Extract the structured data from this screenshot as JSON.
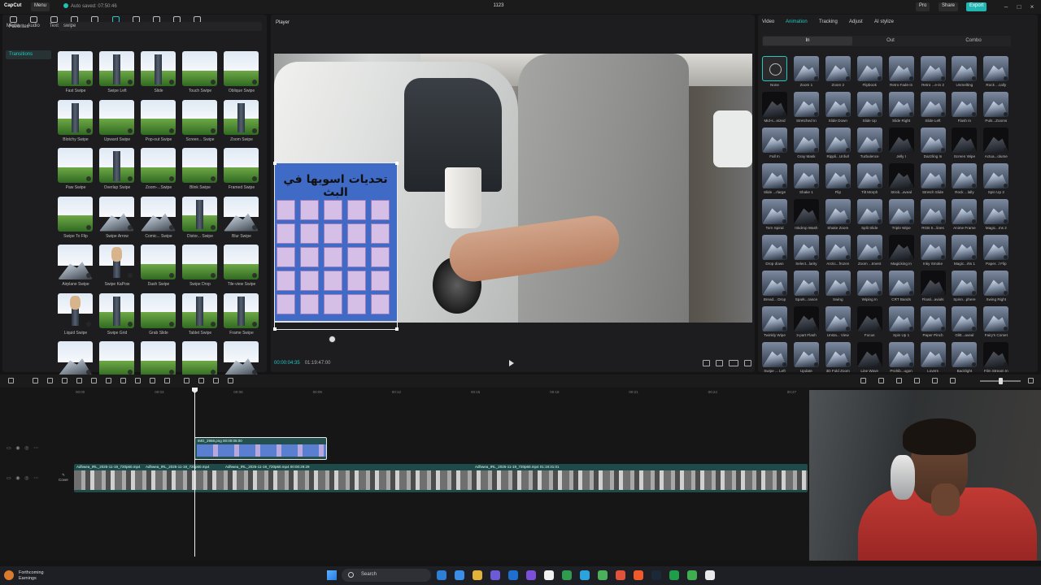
{
  "titlebar": {
    "logo": "CapCut",
    "menu": "Menu",
    "autosave": "Auto saved: 07:50:46",
    "project": "1123",
    "pro": "Pro",
    "share": "Share",
    "export": "Export"
  },
  "left_tools": [
    {
      "label": "Media",
      "icon": "media-icon"
    },
    {
      "label": "Audio",
      "icon": "audio-icon"
    },
    {
      "label": "Text",
      "icon": "text-icon"
    },
    {
      "label": "Stickers",
      "icon": "stickers-icon"
    },
    {
      "label": "Effects",
      "icon": "effects-icon"
    },
    {
      "label": "Transitions",
      "icon": "transitions-icon",
      "active": true
    },
    {
      "label": "Captions",
      "icon": "captions-icon"
    },
    {
      "label": "Filters",
      "icon": "filters-icon"
    },
    {
      "label": "Adjustment",
      "icon": "adjustment-icon"
    },
    {
      "label": "AI avatar",
      "icon": "ai-avatar-icon"
    }
  ],
  "left_nav": {
    "favorites": "Favorites",
    "transitions": "Transitions"
  },
  "search": {
    "value": "swipe"
  },
  "transitions": [
    {
      "label": "Fast Swipe",
      "style": "tower"
    },
    {
      "label": "Swipe Left",
      "style": "tower"
    },
    {
      "label": "Slide",
      "style": "tower"
    },
    {
      "label": "Touch Swipe",
      "style": "grass"
    },
    {
      "label": "Oblique Swipe",
      "style": "grass"
    },
    {
      "label": "Blotchy Swipe",
      "style": "tower"
    },
    {
      "label": "Upward Swipe",
      "style": "grass"
    },
    {
      "label": "Pop-out Swipe",
      "style": "grass"
    },
    {
      "label": "Screen... Swipe",
      "style": "grass"
    },
    {
      "label": "Zoom Swipe",
      "style": "tower"
    },
    {
      "label": "Paw Swipe",
      "style": "grass"
    },
    {
      "label": "Overlap Swipe",
      "style": "tower"
    },
    {
      "label": "Zoom-...Swipe",
      "style": "grass"
    },
    {
      "label": "Blink Swipe",
      "style": "grass"
    },
    {
      "label": "Framed Swipe",
      "style": "grass"
    },
    {
      "label": "Swipe To Flip",
      "style": "grass"
    },
    {
      "label": "Swipe Arrow",
      "style": "mount"
    },
    {
      "label": "Comic... Swipe",
      "style": "mount"
    },
    {
      "label": "Distor... Swipe",
      "style": "tower"
    },
    {
      "label": "Blur Swipe",
      "style": "mount"
    },
    {
      "label": "Airplane Swipe",
      "style": "mount"
    },
    {
      "label": "Swipe KaPow",
      "style": "person"
    },
    {
      "label": "Dash Swipe",
      "style": "grass"
    },
    {
      "label": "Swipe Drop",
      "style": "grass"
    },
    {
      "label": "Tile-view Swipe",
      "style": "grass"
    },
    {
      "label": "Liquid Swipe",
      "style": "person"
    },
    {
      "label": "Swipe Grid",
      "style": "tower"
    },
    {
      "label": "Grab Slide",
      "style": "grass"
    },
    {
      "label": "Tablet Swipe",
      "style": "tower"
    },
    {
      "label": "Frame Swipe",
      "style": "tower"
    },
    {
      "label": "",
      "style": "mount"
    },
    {
      "label": "",
      "style": "grass"
    },
    {
      "label": "",
      "style": "grass"
    },
    {
      "label": "",
      "style": "grass"
    },
    {
      "label": "",
      "style": "mount"
    }
  ],
  "player": {
    "title": "Player",
    "overlay_title": "تحديات اسويها في البث",
    "timecode_current": "00:00:04:35",
    "timecode_total": "01:19:47:00"
  },
  "right_tabs": [
    "Video",
    "Animation",
    "Tracking",
    "Adjust",
    "AI stylize"
  ],
  "anim_subtabs": [
    "In",
    "Out",
    "Combo"
  ],
  "animations": [
    "None",
    "Zoom 1",
    "Zoom 2",
    "Flipbook",
    "Retro Fade-in",
    "Retro ...e-in 2",
    "Unmelting",
    "Rock ...cally",
    "Mid-s...eized",
    "Stretched In",
    "Slide Down",
    "Slide Up",
    "Slide Right",
    "Slide Left",
    "Flash In",
    "Puls...Zooms",
    "Fall In",
    "Gray Mask",
    "Rippli...Unfurl",
    "Turbulence",
    "Jelly I",
    "Dazzling In",
    "Screen Wipe",
    "Actua...olume",
    "Slide ...rlarge",
    "Shake 1",
    "Flip",
    "Tilt Morph",
    "Strob...aveal",
    "Stretch Slide",
    "Rock ...lally",
    "Spin Up 2",
    "Torn Spiral",
    "Inkdrop Wash",
    "Shake Zoom",
    "Split Slide",
    "Triple Wipe",
    "RGB S...lines",
    "Anime Frame",
    "Magic...ms 2",
    "Drop down",
    "Select...larity",
    "Arctic...frozen",
    "Zoom ...tment",
    "Magicking In",
    "Inky Smoke",
    "Magic...rks 1",
    "Paper...l Flip",
    "Bread... Drop",
    "Spark...rance",
    "Swing",
    "Wiping In",
    "CRT Bands",
    "Floati...avials",
    "Spinn...phere",
    "Swing Right",
    "Twinkly Wipe",
    "3-part Flash",
    "Unsta... View",
    "Focus",
    "Spin Up 1",
    "Paper Pinch",
    "Glitt...aveal",
    "Fairy's Comet",
    "Swipe ... Left",
    "Update",
    "3D Fold Zoom",
    "Line Wave",
    "Prohib...ugon",
    "Lovers",
    "Backlight",
    "Film Stream In"
  ],
  "dark_animations": [
    8,
    20,
    22,
    23,
    28,
    33,
    44,
    53,
    57,
    59,
    67,
    71
  ],
  "timeline": {
    "ticks": [
      "00:00",
      "00:03",
      "00:06",
      "00:09",
      "00:12",
      "00:15",
      "00:18",
      "00:21",
      "00:24",
      "00:27"
    ],
    "overlay_clip": "IMG_2958.png  00:00:05:00",
    "main_clips": [
      "Adhwea_IRL_2025-11-19_720p60.mp4",
      "Adhwea_IRL_2025-11-19_720p60.mp4",
      "Adhwea_IRL_2025-11-19_720p60.mp4  00:00:29:29",
      "Adhwea_IRL_2025-11-19_720p60.mp4  01:19:31:01"
    ],
    "cover": "Cover"
  },
  "taskbar": {
    "weather_title": "Forthcoming",
    "weather_sub": "Earnings",
    "search": "Search"
  },
  "colors": {
    "accent": "#22c8c0",
    "panel": "#1d1d1f",
    "overlay_blue": "#3f6bc7"
  }
}
